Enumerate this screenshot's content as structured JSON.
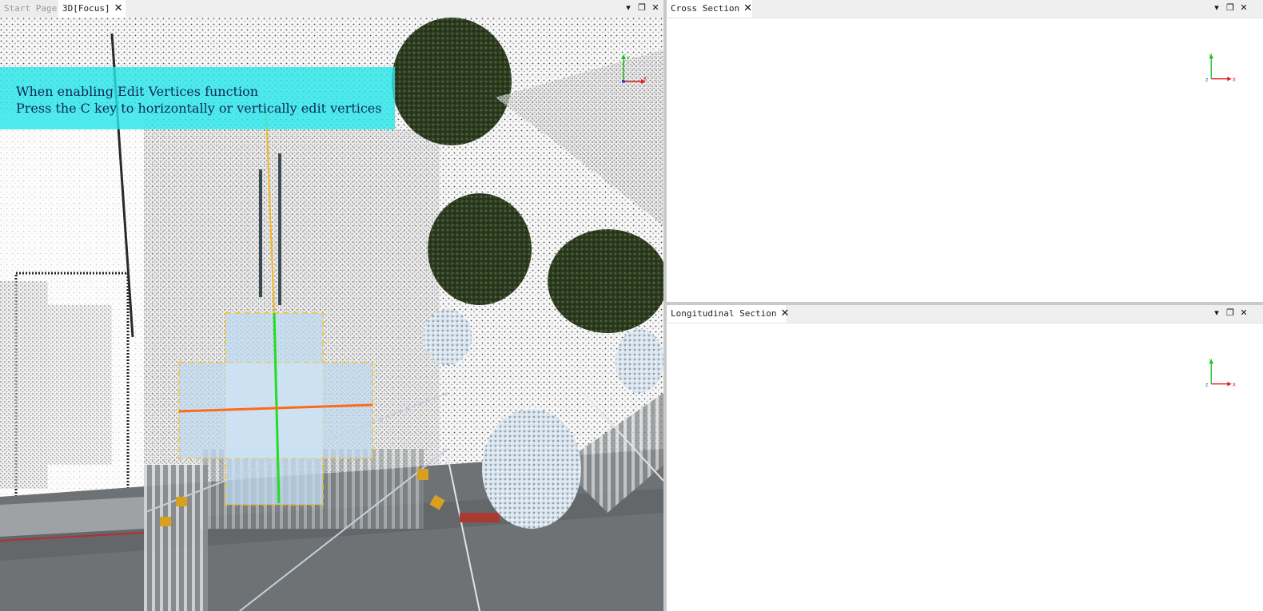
{
  "left_panel": {
    "tabs": [
      {
        "label": "Start Page",
        "active": false
      },
      {
        "label": "3D[Focus]",
        "active": true,
        "closable": true
      }
    ],
    "controls": {
      "dropdown_icon": "chevron-down-icon",
      "float_icon": "restore-window-icon",
      "close_icon": "close-icon"
    },
    "hint": {
      "line1": "When enabling Edit Vertices function",
      "line2": "Press the C key to horizontally or vertically edit vertices"
    },
    "axes": {
      "x": "x",
      "y": "y"
    }
  },
  "cross_section": {
    "tab_label": "Cross Section",
    "axes": {
      "x": "x",
      "y": "y",
      "z": "z"
    }
  },
  "longitudinal_section": {
    "tab_label": "Longitudinal Section",
    "axes": {
      "x": "x",
      "y": "y",
      "z": "z"
    }
  },
  "glyphs": {
    "close": "✕",
    "dropdown": "▾",
    "float": "❐"
  },
  "colors": {
    "hint_bg": "#28e6e8",
    "vertical_line": "#22dd22",
    "horizontal_line": "#ff6a1a",
    "selection_border": "#f2c32a",
    "axis_x": "#e02020",
    "axis_y": "#1fbf1f",
    "axis_z": "#2040e0"
  }
}
